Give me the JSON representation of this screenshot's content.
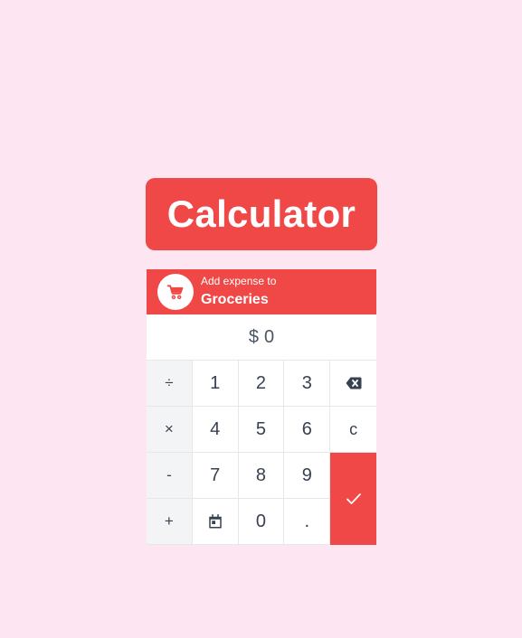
{
  "title": "Calculator",
  "header": {
    "subtitle": "Add expense to",
    "category": "Groceries"
  },
  "display": {
    "currency": "$",
    "amount": "0"
  },
  "keys": {
    "divide": "÷",
    "multiply": "×",
    "minus": "-",
    "plus": "+",
    "one": "1",
    "two": "2",
    "three": "3",
    "four": "4",
    "five": "5",
    "six": "6",
    "seven": "7",
    "eight": "8",
    "nine": "9",
    "zero": "0",
    "decimal": ".",
    "clear": "c"
  },
  "icons": {
    "cart": "cart-icon",
    "backspace": "backspace-icon",
    "calendar": "calendar-icon",
    "submit": "checkmark-icon"
  },
  "colors": {
    "accent": "#f04747",
    "background": "#fde6f1",
    "operator_key_bg": "#f3f4f6",
    "text": "#374151"
  }
}
